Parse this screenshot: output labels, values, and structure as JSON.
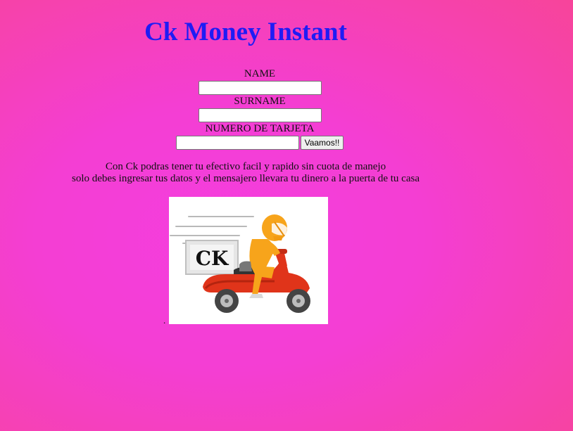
{
  "header": {
    "title": "Ck Money Instant"
  },
  "form": {
    "name_label": "NAME",
    "name_value": "",
    "surname_label": "SURNAME",
    "surname_value": "",
    "card_label": "NUMERO DE TARJETA",
    "card_value": "",
    "submit_label": "Vaamos!!"
  },
  "description": {
    "line1": "Con Ck podras tener tu efectivo facil y rapido sin cuota de manejo",
    "line2": "solo debes ingresar tus datos y el mensajero llevara tu dinero a la puerta de tu casa"
  },
  "image": {
    "logo_text": "CK",
    "stray_char": "."
  },
  "colors": {
    "title": "#1f1cf4",
    "background": "#f53ddf",
    "rider_orange": "#f7a41b",
    "scooter_red": "#e0341a"
  }
}
